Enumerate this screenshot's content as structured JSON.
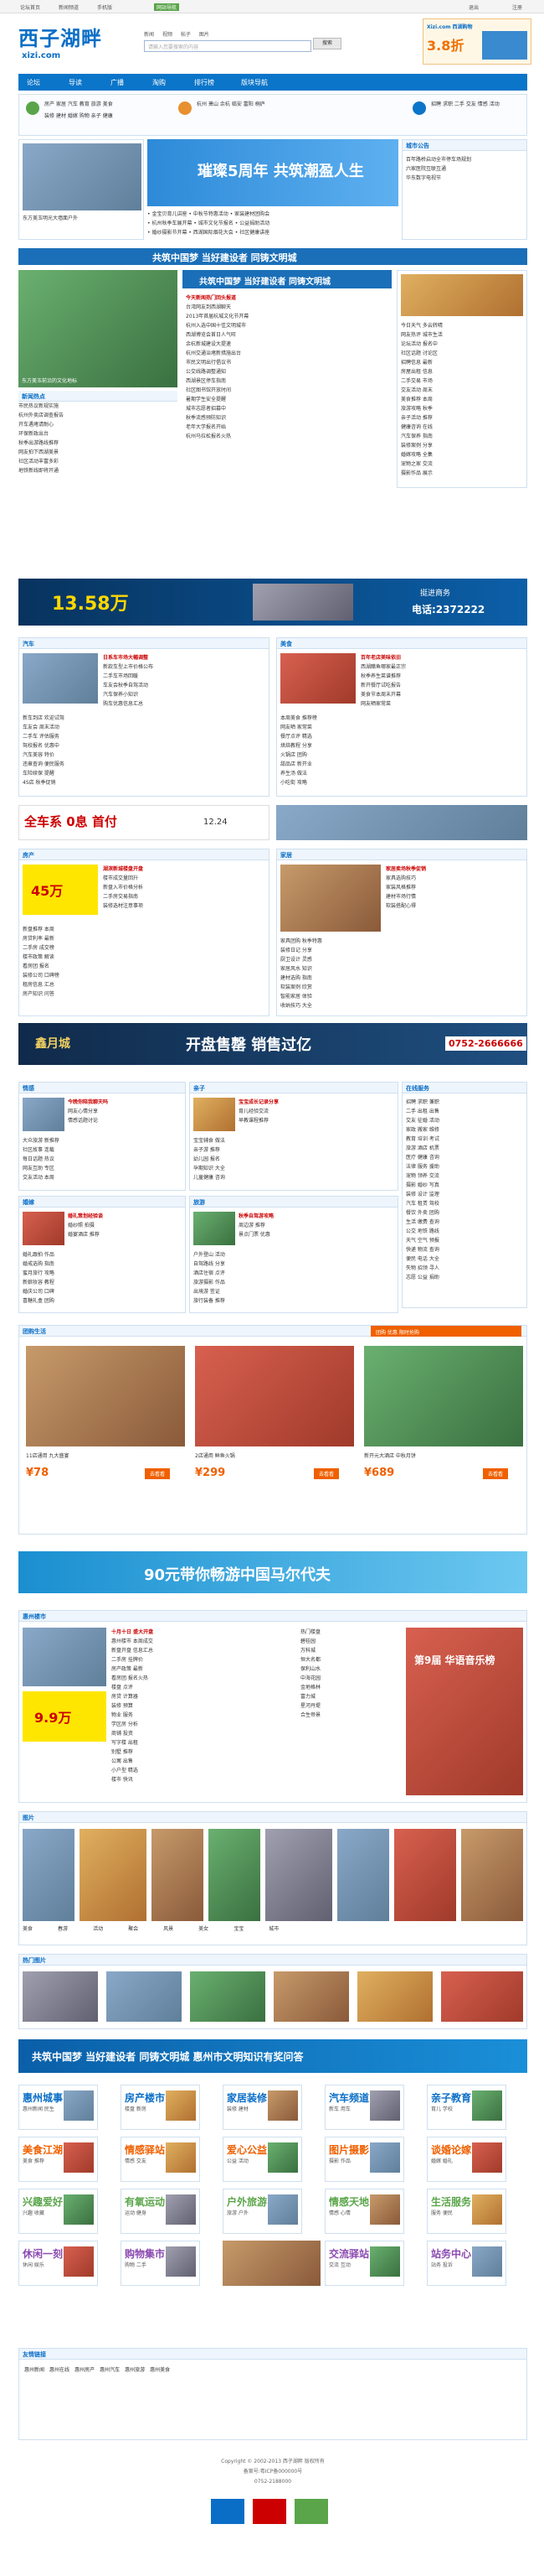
{
  "topbar": {
    "links": [
      "论坛首页",
      "新闻频道",
      "手机版",
      "网站导航"
    ],
    "right": [
      "退出",
      "注册",
      "退出"
    ]
  },
  "logo": {
    "main": "西子湖畔",
    "domain": "xizi.com"
  },
  "search": {
    "tabs": [
      "新闻",
      "视频",
      "帖子",
      "图片"
    ],
    "placeholder": "请输入您要搜索的内容",
    "button": "搜索"
  },
  "top_ad": {
    "brand": "Xizi.com 西湖购物",
    "price": "3.8折"
  },
  "nav": {
    "items": [
      "论坛",
      "导读",
      "广播",
      "淘购",
      "排行榜",
      "版块导航"
    ]
  },
  "subnav": {
    "col1": [
      "房产",
      "家居",
      "汽车",
      "教育",
      "旅游",
      "美食"
    ],
    "col2": [
      "装修",
      "建材",
      "婚嫁",
      "购物",
      "亲子",
      "健康"
    ],
    "col3": [
      "杭州",
      "萧山",
      "余杭",
      "临安",
      "富阳",
      "桐庐"
    ],
    "col4": [
      "招聘",
      "求职",
      "二手",
      "交友",
      "情感",
      "活动"
    ]
  },
  "hero": {
    "left_title": "东方美玉明光大墙面户外",
    "banner_text": "璀璨5周年 共筑潮盈人生",
    "notice_title": "城市公告",
    "notice_items": [
      "百年路桥启动全市停车场规划",
      "六家医院互联互通",
      "华东数字电视节"
    ]
  },
  "wenming": {
    "text": "共筑中国梦 当好建设者 同铸文明城",
    "sub": "共筑中国梦 当好建设者 同铸文明城"
  },
  "news_main": {
    "headline": "东方美玉前沿的文化地标",
    "items": [
      "今天新闻热门回头报道",
      "台湾网友到西湖聊天",
      "2013年首届杭城文化节开幕",
      "杭州入选中国十佳文明城市",
      "西湖博览会首日人气旺",
      "余杭新城建设大提速"
    ],
    "left_list": [
      "市民热议新规实施",
      "杭州外卖店调查报告",
      "开车遇堵请耐心",
      "环保新政出台",
      "秋季出游路线推荐",
      "网友拍下西湖美景",
      "社区活动丰富多彩",
      "地铁新线即将开通"
    ]
  },
  "car_ad": {
    "price": "13.58万",
    "phone": "电话:2372222",
    "slogan": "挺进商务"
  },
  "auto": {
    "title": "汽车",
    "headline": "日系车市场大幅调整",
    "items": [
      "新款车型上市价格公布",
      "二手车市场回暖",
      "车友会秋季自驾活动",
      "汽车保养小知识",
      "购车优惠信息汇总"
    ]
  },
  "food": {
    "title": "美食",
    "headline": "百年老店美味依旧",
    "items": [
      "西湖醋鱼哪家最正宗",
      "秋季养生菜谱推荐",
      "新开餐厅试吃报告",
      "美食节本周末开幕",
      "网友晒家常菜"
    ]
  },
  "promo1": {
    "text": "全车系 0息 首付",
    "price": "12.24"
  },
  "house": {
    "title": "房产",
    "headline": "湖滨新城楼盘开盘",
    "price": "45万",
    "items": [
      "楼市成交量回升",
      "新盘入市价格分析",
      "二手房交易指南",
      "装修选材注意事项"
    ]
  },
  "home": {
    "title": "家居",
    "headline": "家居卖场秋季促销",
    "items": [
      "家具选购技巧",
      "家装风格推荐",
      "建材市场行情",
      "软装搭配心得"
    ]
  },
  "sale_banner": {
    "left": "鑫月城",
    "mid": "开盘售罄 销售过亿",
    "phone": "0752-2666666"
  },
  "forums": [
    {
      "title": "情感",
      "headline": "今晚你陪我聊天吗"
    },
    {
      "title": "亲子",
      "headline": "宝宝成长记录分享"
    },
    {
      "title": "婚嫁",
      "headline": "婚礼策划经验谈"
    },
    {
      "title": "旅游",
      "headline": "秋季自驾游攻略"
    }
  ],
  "deals": {
    "title": "团购生活",
    "items": [
      {
        "name": "11店通用 九大盛宴",
        "price": "¥78",
        "btn": "去看看"
      },
      {
        "name": "2店通用 鲜鱼火锅",
        "price": "¥299",
        "btn": "去看看"
      },
      {
        "name": "新开元大酒店 中秋月饼",
        "price": "¥689",
        "btn": "去看看"
      }
    ]
  },
  "banner_90": {
    "text": "90元带你畅游中国马尔代夫"
  },
  "huizhou": {
    "title": "惠州楼市",
    "headline": "十月十日 盛大开盘",
    "price": "9.9万",
    "ad": "第9届 华语音乐榜"
  },
  "photos": {
    "title": "图片",
    "items": [
      "美食",
      "春游",
      "活动",
      "聚会",
      "风景",
      "美女",
      "宝宝",
      "城市"
    ]
  },
  "gallery": {
    "title": "热门图片",
    "items": [
      "湖滨",
      "西湖",
      "断桥",
      "雷峰塔",
      "苏堤",
      "灵隐"
    ]
  },
  "bottom_banner": {
    "text": "共筑中国梦 当好建设者 同铸文明城 惠州市文明知识有奖问答"
  },
  "tiles": [
    {
      "name": "惠州城事",
      "sub": "惠州新闻 民生"
    },
    {
      "name": "房产楼市",
      "sub": "楼盘 新房"
    },
    {
      "name": "家居装修",
      "sub": "装修 建材"
    },
    {
      "name": "汽车频道",
      "sub": "新车 用车"
    },
    {
      "name": "亲子教育",
      "sub": "育儿 学校"
    },
    {
      "name": "美食江湖",
      "sub": "美食 推荐"
    },
    {
      "name": "情感驿站",
      "sub": "情感 交友"
    },
    {
      "name": "爱心公益",
      "sub": "公益 活动"
    },
    {
      "name": "图片摄影",
      "sub": "摄影 作品"
    },
    {
      "name": "谈婚论嫁",
      "sub": "婚嫁 婚礼"
    },
    {
      "name": "兴趣爱好",
      "sub": "兴趣 收藏"
    },
    {
      "name": "有氧运动",
      "sub": "运动 健身"
    },
    {
      "name": "户外旅游",
      "sub": "旅游 户外"
    },
    {
      "name": "情感天地",
      "sub": "情感 心情"
    },
    {
      "name": "生活服务",
      "sub": "服务 便民"
    },
    {
      "name": "休闲一刻",
      "sub": "休闲 娱乐"
    },
    {
      "name": "购物集市",
      "sub": "购物 二手"
    },
    {
      "name": "交流驿站",
      "sub": "交流 互动"
    },
    {
      "name": "站务中心",
      "sub": "站务 投诉"
    }
  ],
  "friend_links": {
    "title": "友情链接",
    "items": [
      "惠州新闻",
      "惠州在线",
      "惠州房产",
      "惠州汽车",
      "惠州旅游",
      "惠州美食"
    ]
  },
  "footer": {
    "copy": "Copyright © 2002-2013 西子湖畔 版权所有",
    "icp": "备案号:粤ICP备000000号",
    "phone": "0752-2188000"
  },
  "colors": {
    "brand": "#0b75c9",
    "accent": "#f06000"
  }
}
